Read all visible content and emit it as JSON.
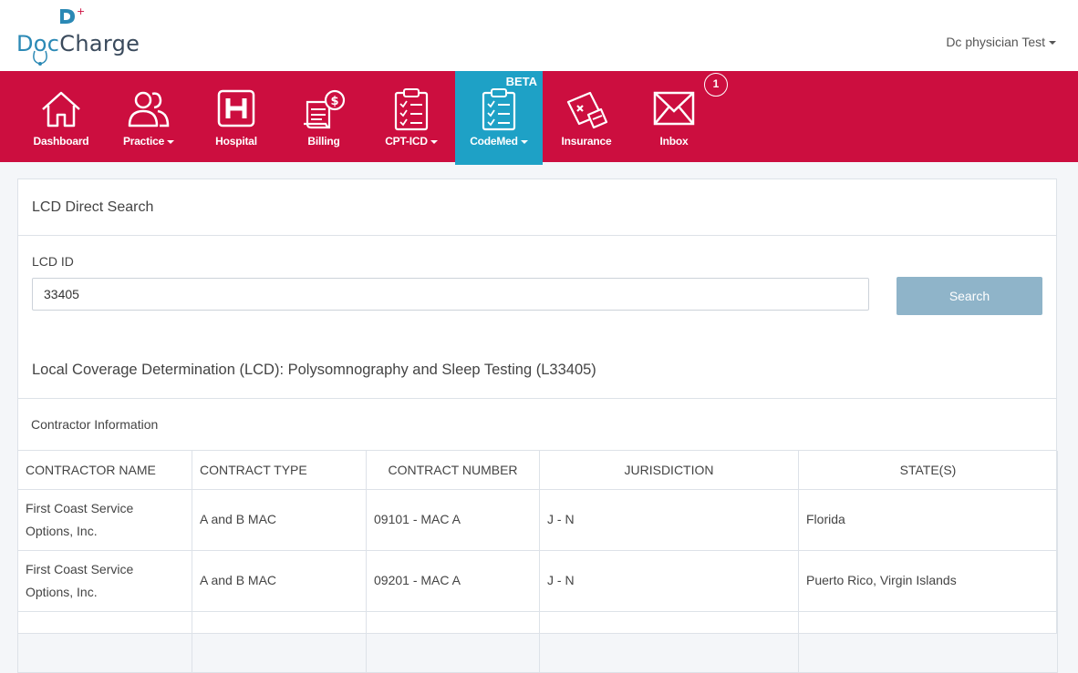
{
  "header": {
    "logo_text_doc": "Doc",
    "logo_text_charge": "Charge",
    "user_name": "Dc physician Test"
  },
  "nav": {
    "items": [
      {
        "label": "Dashboard",
        "icon": "house-icon",
        "dropdown": false
      },
      {
        "label": "Practice",
        "icon": "users-icon",
        "dropdown": true
      },
      {
        "label": "Hospital",
        "icon": "hospital-icon",
        "dropdown": false
      },
      {
        "label": "Billing",
        "icon": "billing-icon",
        "dropdown": false
      },
      {
        "label": "CPT-ICD",
        "icon": "clipboard-checklist-icon",
        "dropdown": true
      },
      {
        "label": "CodeMed",
        "icon": "clipboard-checklist-icon",
        "dropdown": true,
        "active": true,
        "tag": "BETA"
      },
      {
        "label": "Insurance",
        "icon": "insurance-card-icon",
        "dropdown": false
      },
      {
        "label": "Inbox",
        "icon": "envelope-icon",
        "dropdown": false
      }
    ],
    "inbox_badge": "1"
  },
  "panel": {
    "heading": "LCD Direct Search",
    "field_label": "LCD ID",
    "field_value": "33405",
    "search_label": "Search",
    "lcd_title": "Local Coverage Determination (LCD): Polysomnography and Sleep Testing (L33405)"
  },
  "contractor": {
    "heading": "Contractor Information",
    "columns": [
      "CONTRACTOR NAME",
      "CONTRACT TYPE",
      "CONTRACT NUMBER",
      "JURISDICTION",
      "STATE(S)"
    ],
    "rows": [
      [
        "First Coast Service Options, Inc.",
        "A and B MAC",
        "09101 - MAC A",
        "J - N",
        "Florida"
      ],
      [
        "First Coast Service Options, Inc.",
        "A and B MAC",
        "09201 - MAC A",
        "J - N",
        "Puerto Rico, Virgin Islands"
      ]
    ]
  },
  "colors": {
    "nav_bg": "#cc0e3f",
    "nav_active": "#1ea1c6",
    "search_button": "#8fb4c9",
    "logo_blue": "#2b89b5"
  }
}
